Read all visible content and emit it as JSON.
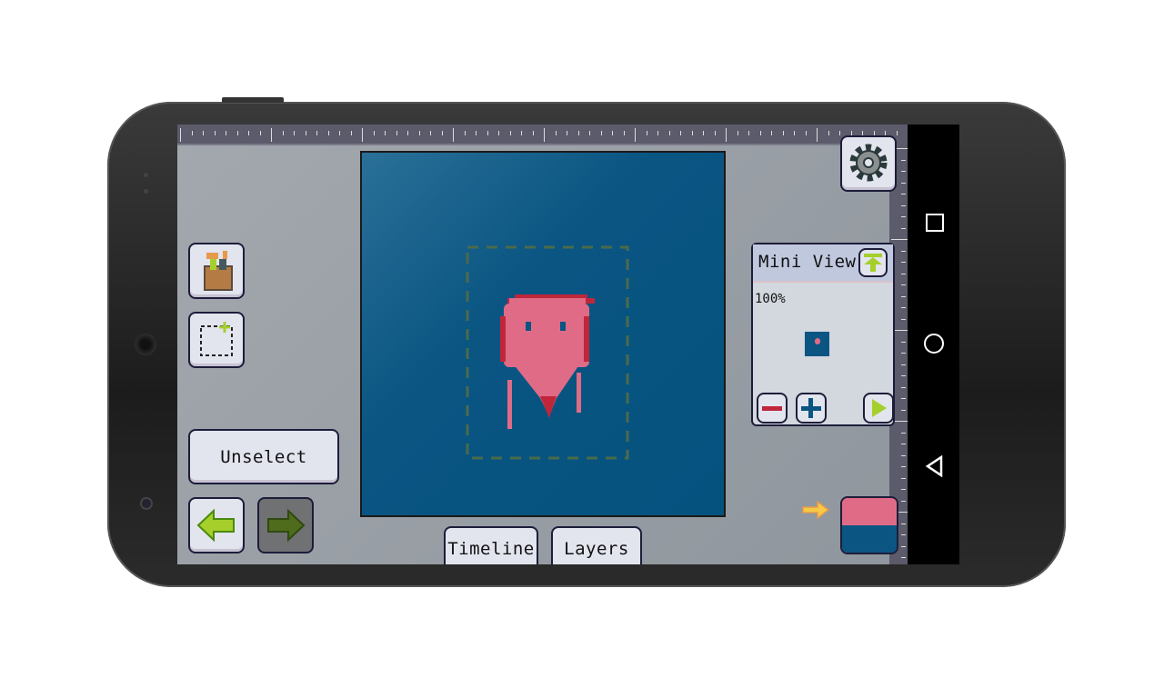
{
  "app": {
    "toolbar": {
      "unselect_label": "Unselect"
    },
    "tabs": [
      {
        "label": "Timeline"
      },
      {
        "label": "Layers"
      }
    ],
    "mini_view": {
      "title": "Mini View",
      "zoom": "100%"
    },
    "colors": {
      "primary": "#e06b86",
      "secondary": "#0a5582",
      "canvas_bg": "#0a5582",
      "accent_green": "#a6cf2b"
    },
    "icons": [
      "tool-bag-icon",
      "add-selection-icon",
      "undo-arrow-icon",
      "redo-arrow-icon",
      "gear-icon",
      "pin-icon",
      "zoom-out-icon",
      "zoom-in-icon",
      "play-icon",
      "swap-arrow-icon"
    ]
  },
  "android_nav": {
    "icons": [
      "recents-icon",
      "home-icon",
      "back-icon"
    ]
  }
}
